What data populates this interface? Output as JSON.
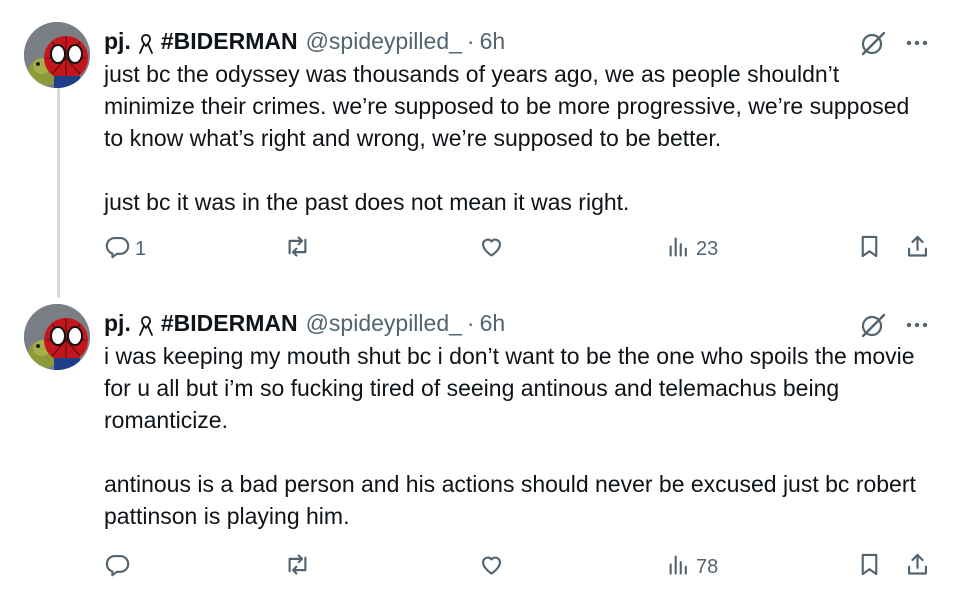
{
  "tweets": [
    {
      "display_name": "pj.",
      "name_suffix": "#BIDERMAN",
      "handle": "@spideypilled_",
      "separator": "·",
      "time": "6h",
      "text": "just bc the odyssey was thousands of years ago, we as people shouldn’t minimize their crimes. we’re supposed to be more progressive, we’re supposed to know what’s right and wrong, we’re supposed to be better.\n\njust bc it was in the past does not mean it was right.",
      "replies": "1",
      "reposts": "",
      "likes": "",
      "views": "23"
    },
    {
      "display_name": "pj.",
      "name_suffix": "#BIDERMAN",
      "handle": "@spideypilled_",
      "separator": "·",
      "time": "6h",
      "text": "i was keeping my mouth shut bc i don’t want to be the one who spoils the movie for u all but i’m so fucking tired of seeing antinous and telemachus being romanticize.\n\nantinous is a bad person and his actions should never be excused just bc robert pattinson is playing him.",
      "replies": "",
      "reposts": "",
      "likes": "",
      "views": "78"
    }
  ],
  "icons": {
    "name_badge": "ribbon-icon",
    "grok": "grok-icon",
    "more": "more-icon",
    "reply": "reply-icon",
    "repost": "repost-icon",
    "like": "heart-icon",
    "views": "views-icon",
    "bookmark": "bookmark-icon",
    "share": "share-icon"
  },
  "colors": {
    "text": "#0f1419",
    "secondary": "#536471",
    "thread_line": "#cfd9de",
    "background": "#ffffff"
  }
}
